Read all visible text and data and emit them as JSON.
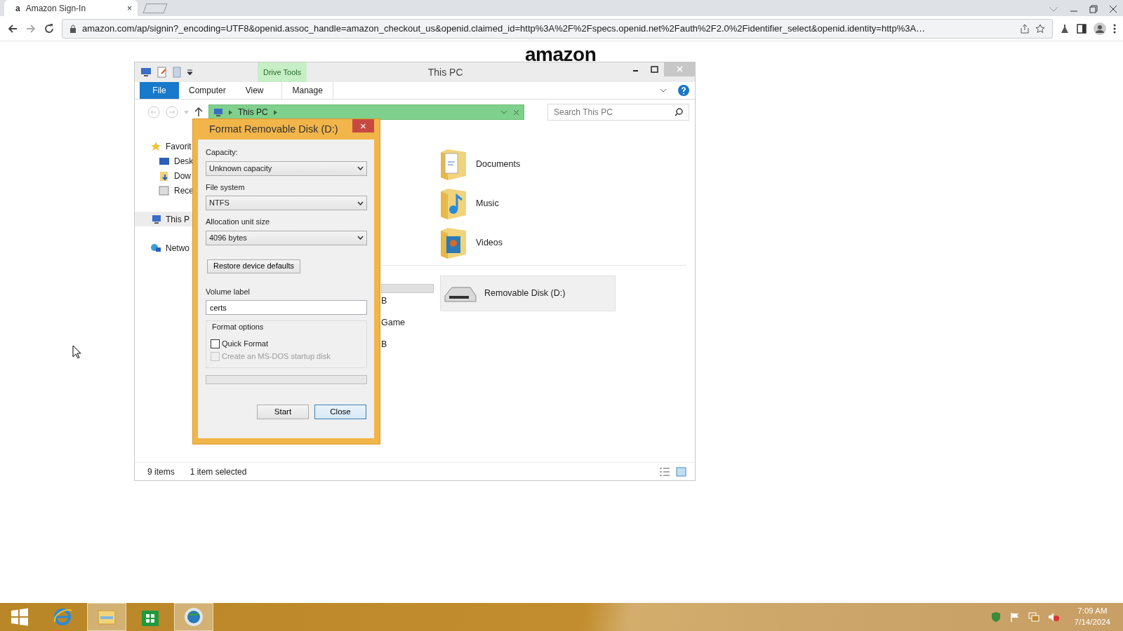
{
  "browser": {
    "tab": {
      "title": "Amazon Sign-In",
      "favicon": "a",
      "close": "×"
    },
    "url": "amazon.com/ap/signin?_encoding=UTF8&openid.assoc_handle=amazon_checkout_us&openid.claimed_id=http%3A%2F%2Fspecs.openid.net%2Fauth%2F2.0%2Fidentifier_select&openid.identity=http%3A…"
  },
  "page": {
    "logo": "amazon"
  },
  "explorer": {
    "title": "This PC",
    "context_tab": "Drive Tools",
    "ribbon_tabs": [
      {
        "label": "File",
        "kind": "file"
      },
      {
        "label": "Computer",
        "kind": "tab"
      },
      {
        "label": "View",
        "kind": "tab"
      },
      {
        "label": "Manage",
        "kind": "context"
      }
    ],
    "path": [
      "This PC"
    ],
    "search": {
      "placeholder": "Search This PC"
    },
    "nav": [
      {
        "label": "Favorit",
        "kind": "favorites",
        "selected": false,
        "children": [
          {
            "label": "Desk",
            "kind": "desktop",
            "selected": false
          },
          {
            "label": "Dow",
            "kind": "downloads",
            "selected": false
          },
          {
            "label": "Rece",
            "kind": "recent",
            "selected": false
          }
        ]
      },
      {
        "label": "This P",
        "kind": "pc",
        "selected": true
      },
      {
        "label": "Netwo",
        "kind": "network",
        "selected": false
      }
    ],
    "folders": [
      {
        "label": "Documents",
        "kind": "documents"
      },
      {
        "label": "Music",
        "kind": "music"
      },
      {
        "label": "Videos",
        "kind": "videos"
      }
    ],
    "hidden_drive_texts": [
      "B",
      "Game",
      "B"
    ],
    "drives": [
      {
        "label": "Removable Disk (D:)",
        "kind": "removable",
        "selected": true
      }
    ],
    "status": {
      "count": "9 items",
      "selection": "1 item selected"
    }
  },
  "dialog": {
    "title": "Format Removable Disk (D:)",
    "close": "×",
    "fields": [
      {
        "label": "Capacity:",
        "value": "Unknown capacity"
      },
      {
        "label": "File system",
        "value": "NTFS"
      },
      {
        "label": "Allocation unit size",
        "value": "4096 bytes"
      }
    ],
    "restore_button": "Restore device defaults",
    "volume": {
      "label": "Volume label",
      "value": "certs"
    },
    "format_options": {
      "title": "Format options",
      "options": [
        {
          "label": "Quick Format",
          "checked": false,
          "disabled": false
        },
        {
          "label": "Create an MS-DOS startup disk",
          "checked": false,
          "disabled": true
        }
      ]
    },
    "progress": {
      "level": 0
    },
    "buttons": [
      {
        "label": "Start",
        "focused": false
      },
      {
        "label": "Close",
        "focused": true
      }
    ]
  },
  "taskbar": {
    "apps": [
      {
        "kind": "ie",
        "active": false
      },
      {
        "kind": "explorer",
        "active": true
      },
      {
        "kind": "store",
        "active": false
      },
      {
        "kind": "globe",
        "active": true
      }
    ],
    "time": "7:09 AM",
    "date": "7/14/2024"
  }
}
